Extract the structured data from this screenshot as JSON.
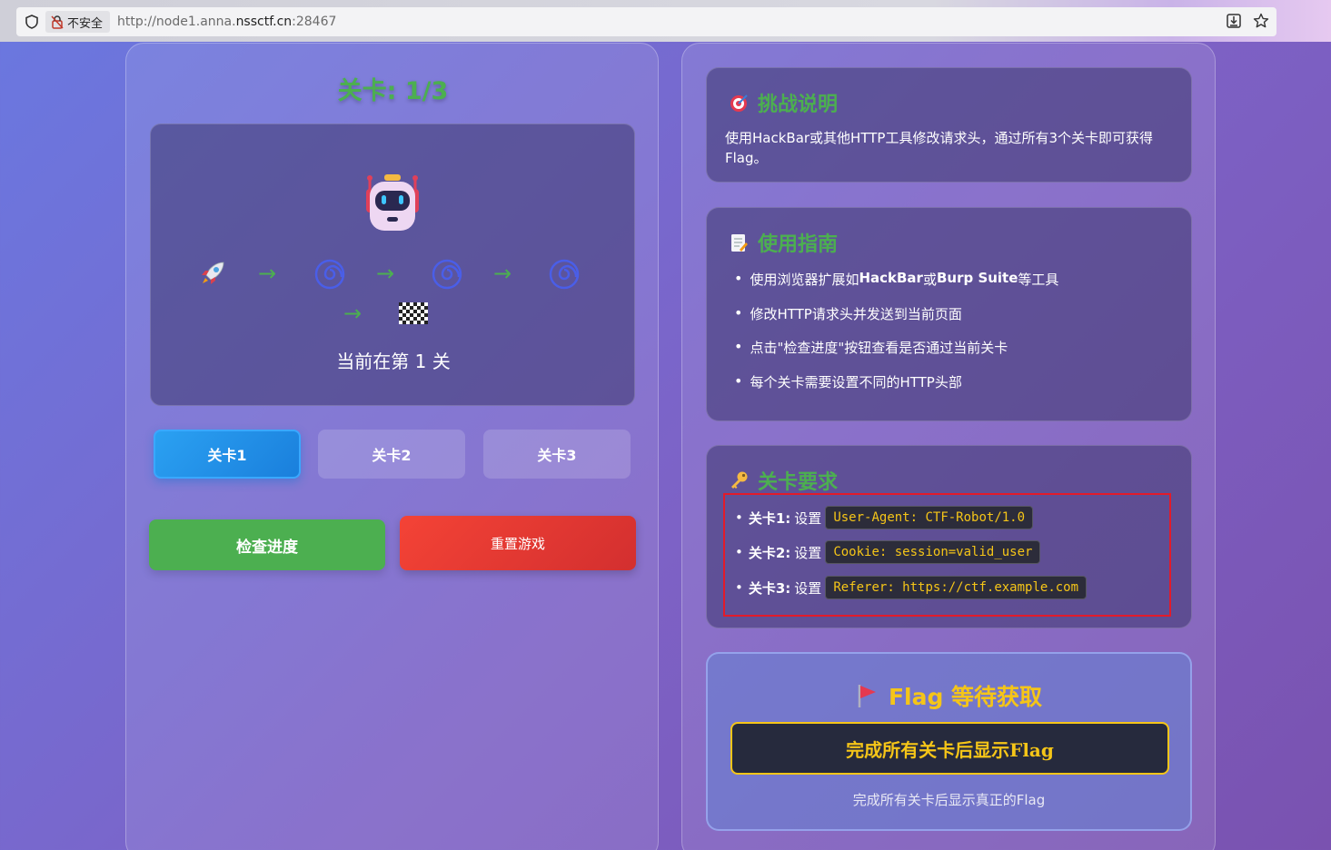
{
  "browser": {
    "security_label": "不安全",
    "url_prefix": "http://node1.anna.",
    "url_host": "nssctf.cn",
    "url_port": ":28467"
  },
  "game": {
    "level_title": "关卡: 1/3",
    "path_icons": [
      "rocket-icon",
      "swirl-icon",
      "swirl-icon",
      "swirl-icon",
      "checkered-flag-icon"
    ],
    "arrow_glyph": "→",
    "current_level_text": "当前在第 1 关",
    "level_buttons": [
      {
        "label": "关卡1",
        "active": true
      },
      {
        "label": "关卡2",
        "active": false
      },
      {
        "label": "关卡3",
        "active": false
      }
    ],
    "check_button": "检查进度",
    "reset_button": "重置游戏"
  },
  "challenge": {
    "title": "挑战说明",
    "text": "使用HackBar或其他HTTP工具修改请求头，通过所有3个关卡即可获得Flag。"
  },
  "guide": {
    "title": "使用指南",
    "items": [
      {
        "pre": "使用浏览器扩展如 ",
        "b1": "HackBar",
        "mid": " 或 ",
        "b2": "Burp Suite",
        "post": " 等工具"
      },
      {
        "text": "修改HTTP请求头并发送到当前页面"
      },
      {
        "text": "点击\"检查进度\"按钮查看是否通过当前关卡"
      },
      {
        "text": "每个关卡需要设置不同的HTTP头部"
      }
    ]
  },
  "requirements": {
    "title": "关卡要求",
    "items": [
      {
        "level": "关卡1:",
        "action": "设置",
        "header": "User-Agent: CTF-Robot/1.0"
      },
      {
        "level": "关卡2:",
        "action": "设置",
        "header": "Cookie: session=valid_user"
      },
      {
        "level": "关卡3:",
        "action": "设置",
        "header": "Referer: https://ctf.example.com"
      }
    ]
  },
  "flag": {
    "title": "Flag 等待获取",
    "box_text": "完成所有关卡后显示Flag",
    "note": "完成所有关卡后显示真正的Flag"
  },
  "colors": {
    "accent_green": "#4caf50",
    "flag_yellow": "#f5c518",
    "active_blue": "#2196f3",
    "reset_red": "#f44336",
    "highlight_red": "#e21b2a"
  }
}
